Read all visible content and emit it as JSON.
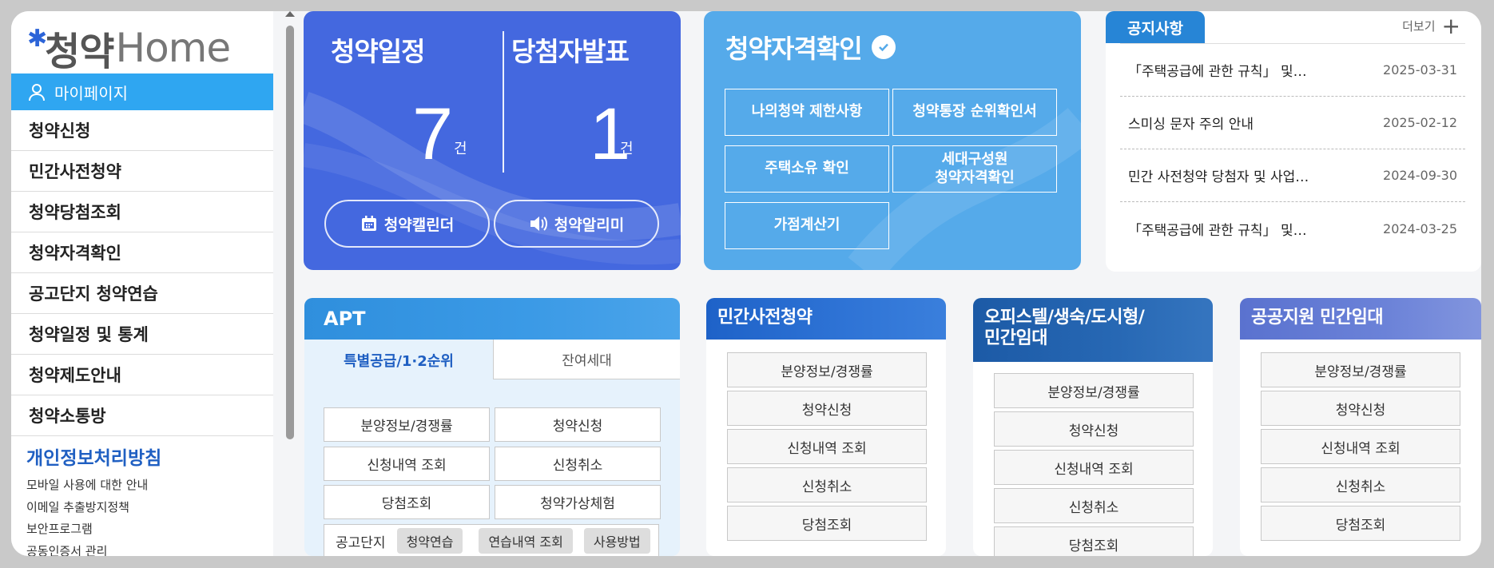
{
  "sidebar": {
    "logo_ko": "청약",
    "logo_home": "Home",
    "mypage": "마이페이지",
    "menu": [
      "청약신청",
      "민간사전청약",
      "청약당첨조회",
      "청약자격확인",
      "공고단지 청약연습",
      "청약일정 및 통계",
      "청약제도안내",
      "청약소통방"
    ],
    "privacy": "개인정보처리방침",
    "links": [
      "모바일 사용에 대한 안내",
      "이메일 추출방지정책",
      "보안프로그램",
      "공동인증서 관리"
    ]
  },
  "schedule": {
    "title_schedule": "청약일정",
    "title_winner": "당첨자발표",
    "schedule_count": "7",
    "winner_count": "1",
    "unit": "건",
    "calendar_label": "청약캘린더",
    "alarm_label": "청약알리미"
  },
  "eligibility": {
    "title": "청약자격확인",
    "buttons": [
      "나의청약 제한사항",
      "청약통장 순위확인서",
      "주택소유 확인",
      "세대구성원\n청약자격확인",
      "가점계산기"
    ]
  },
  "notice": {
    "tab": "공지사항",
    "more": "더보기",
    "items": [
      {
        "title": "「주택공급에 관한 규칙」 및…",
        "date": "2025-03-31"
      },
      {
        "title": "스미싱 문자 주의 안내",
        "date": "2025-02-12"
      },
      {
        "title": "민간 사전청약 당첨자 및 사업…",
        "date": "2024-09-30"
      },
      {
        "title": "「주택공급에 관한 규칙」 및…",
        "date": "2024-03-25"
      }
    ]
  },
  "apt": {
    "title": "APT",
    "tab_active": "특별공급/1·2순위",
    "tab_inactive": "잔여세대",
    "buttons": [
      "분양정보/경쟁률",
      "청약신청",
      "신청내역 조회",
      "신청취소",
      "당첨조회",
      "청약가상체험"
    ],
    "complex_label": "공고단지",
    "chips": [
      "청약연습",
      "연습내역 조회",
      "사용방법"
    ]
  },
  "private_pre": {
    "title": "민간사전청약",
    "buttons": [
      "분양정보/경쟁률",
      "청약신청",
      "신청내역 조회",
      "신청취소",
      "당첨조회"
    ]
  },
  "officetel": {
    "title": "오피스텔/생숙/도시형/\n민간임대",
    "buttons": [
      "분양정보/경쟁률",
      "청약신청",
      "신청내역 조회",
      "신청취소",
      "당첨조회"
    ]
  },
  "public_rental": {
    "title": "공공지원 민간임대",
    "buttons": [
      "분양정보/경쟁률",
      "청약신청",
      "신청내역 조회",
      "신청취소",
      "당첨조회"
    ]
  },
  "colors": {
    "schedule_bg": "#4468df",
    "elig_bg": "#55aaea",
    "mypage_bg": "#2fa6f1",
    "notice_tab": "#2785d6",
    "private_head": "#1e62c8",
    "officetel_head": "#1c5aa6",
    "public_head": "#5a72cf"
  }
}
